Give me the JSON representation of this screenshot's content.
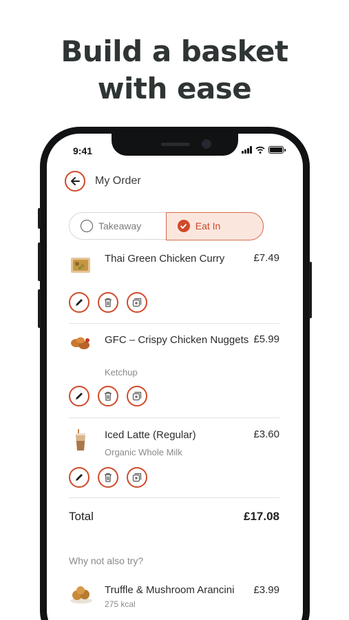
{
  "headline": {
    "line1": "Build a basket",
    "line2": "with ease"
  },
  "status": {
    "time": "9:41"
  },
  "header": {
    "title": "My Order"
  },
  "order_type": {
    "options": [
      "Takeaway",
      "Eat In"
    ],
    "selected": "Eat In"
  },
  "items": [
    {
      "name": "Thai Green Chicken Curry",
      "price": "£7.49",
      "sub": ""
    },
    {
      "name": "GFC – Crispy Chicken Nuggets",
      "price": "£5.99",
      "sub": "Ketchup"
    },
    {
      "name": "Iced Latte (Regular)",
      "price": "£3.60",
      "sub": "Organic Whole Milk"
    }
  ],
  "total": {
    "label": "Total",
    "value": "£17.08"
  },
  "suggestions": {
    "title": "Why not also try?",
    "items": [
      {
        "name": "Truffle & Mushroom Arancini",
        "kcal": "275 kcal",
        "price": "£3.99"
      }
    ]
  },
  "colors": {
    "accent": "#cf4a2a",
    "accent_light": "#fbe6de",
    "headline": "#2f3435"
  },
  "icons": {
    "back": "arrow-left-icon",
    "edit": "pencil-icon",
    "delete": "trash-icon",
    "duplicate": "duplicate-icon",
    "selected": "check-icon"
  }
}
